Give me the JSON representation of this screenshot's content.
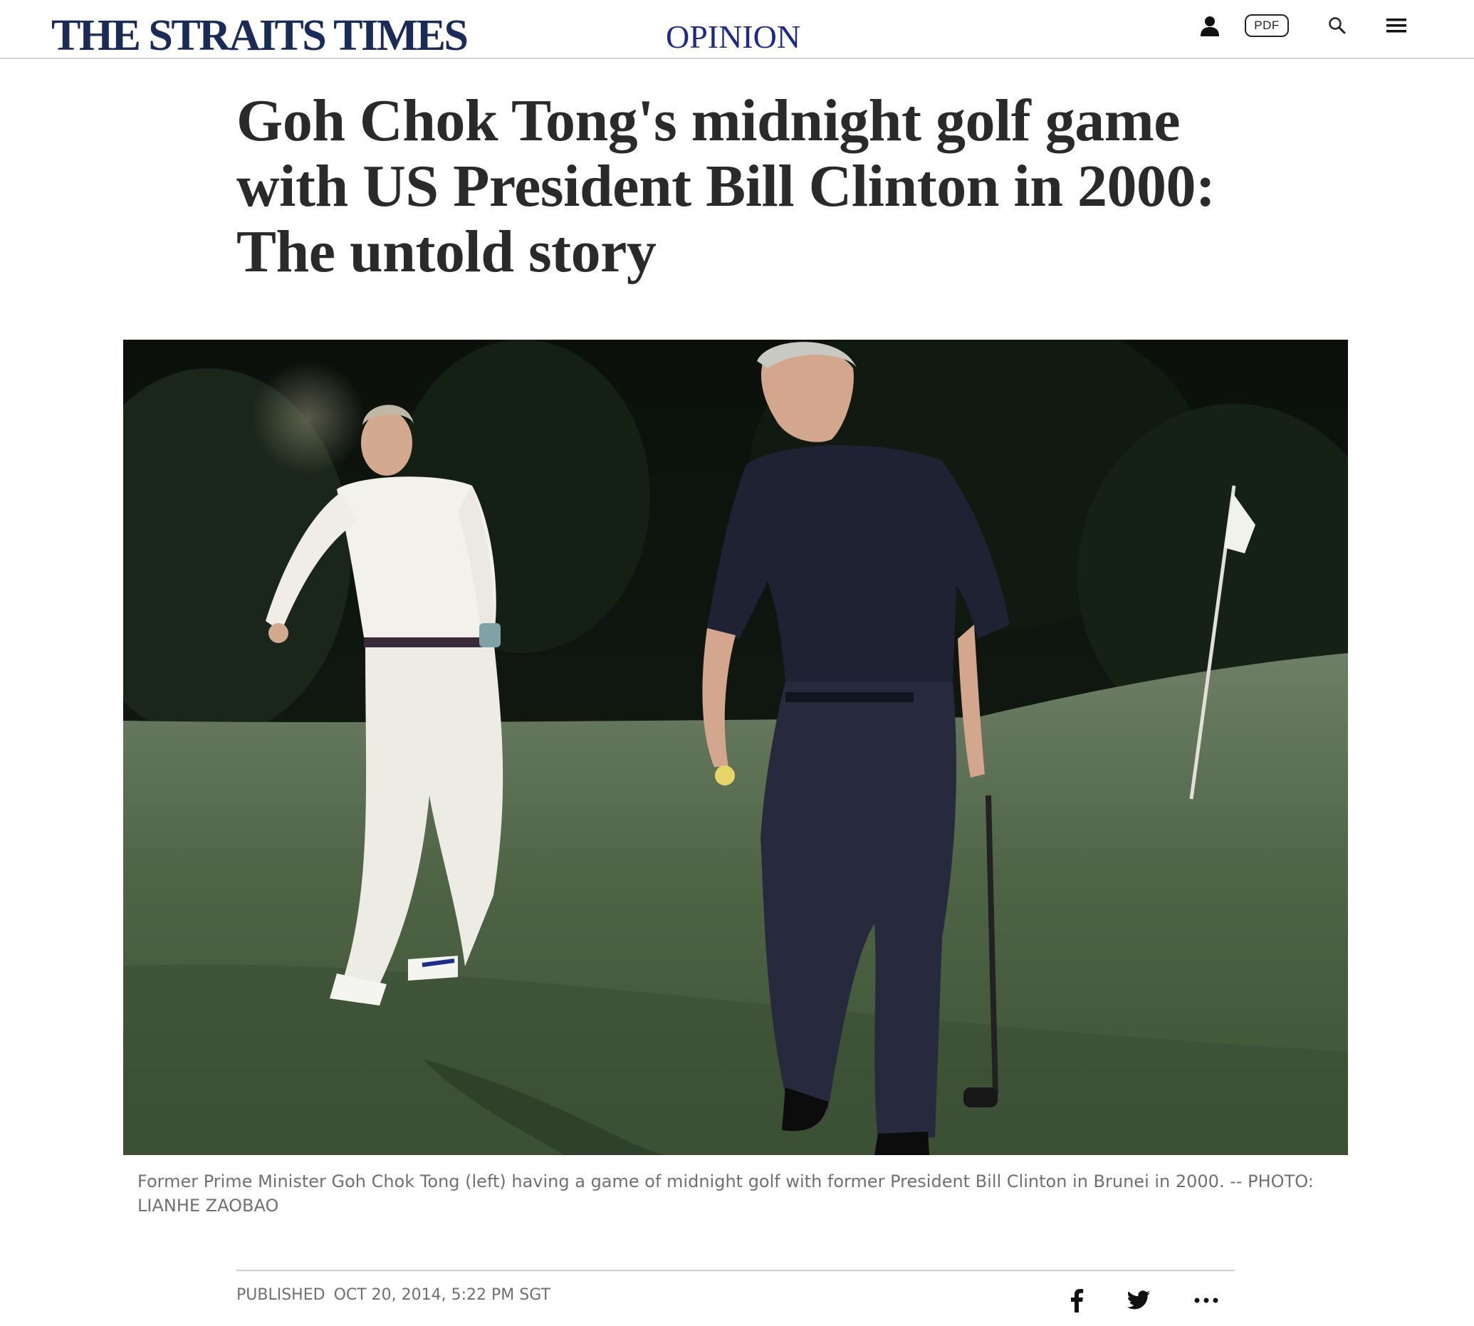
{
  "header": {
    "logo": "THE STRAITS TIMES",
    "section": "OPINION",
    "pdf_label": "PDF",
    "icons": [
      "user-icon",
      "search-icon",
      "hamburger-menu-icon"
    ]
  },
  "article": {
    "title": "Goh Chok Tong's midnight golf game with US President Bill Clinton in 2000: The untold story",
    "caption": "Former Prime Minister Goh Chok Tong (left) having a game of midnight golf with former President Bill Clinton in Brunei in 2000. -- PHOTO: LIANHE ZAOBAO",
    "published_label": "PUBLISHED",
    "published_date": "OCT 20, 2014, 5:22 PM SGT"
  },
  "share": {
    "icons": [
      "facebook-icon",
      "twitter-icon",
      "more-options-icon"
    ]
  },
  "colors": {
    "logo": "#1a2b57",
    "section": "#1d2a8c",
    "headline": "#2a2a2a",
    "caption": "#707070"
  }
}
